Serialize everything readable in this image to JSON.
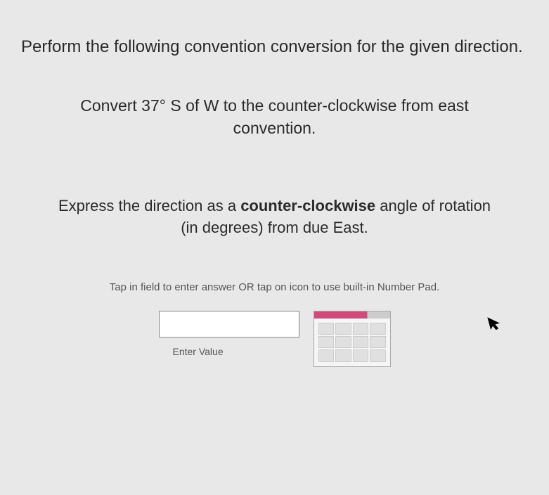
{
  "question": {
    "intro": "Perform the following convention conversion for the given direction.",
    "body": "Convert 37° S of W to the counter-clockwise from east convention.",
    "instruction_prefix": "Express the direction as a ",
    "instruction_bold": "counter-clockwise",
    "instruction_suffix": " angle of rotation (in degrees) from due East."
  },
  "input": {
    "hint": "Tap in field to enter answer OR tap on icon to use built-in Number Pad.",
    "value": "",
    "label": "Enter Value"
  }
}
